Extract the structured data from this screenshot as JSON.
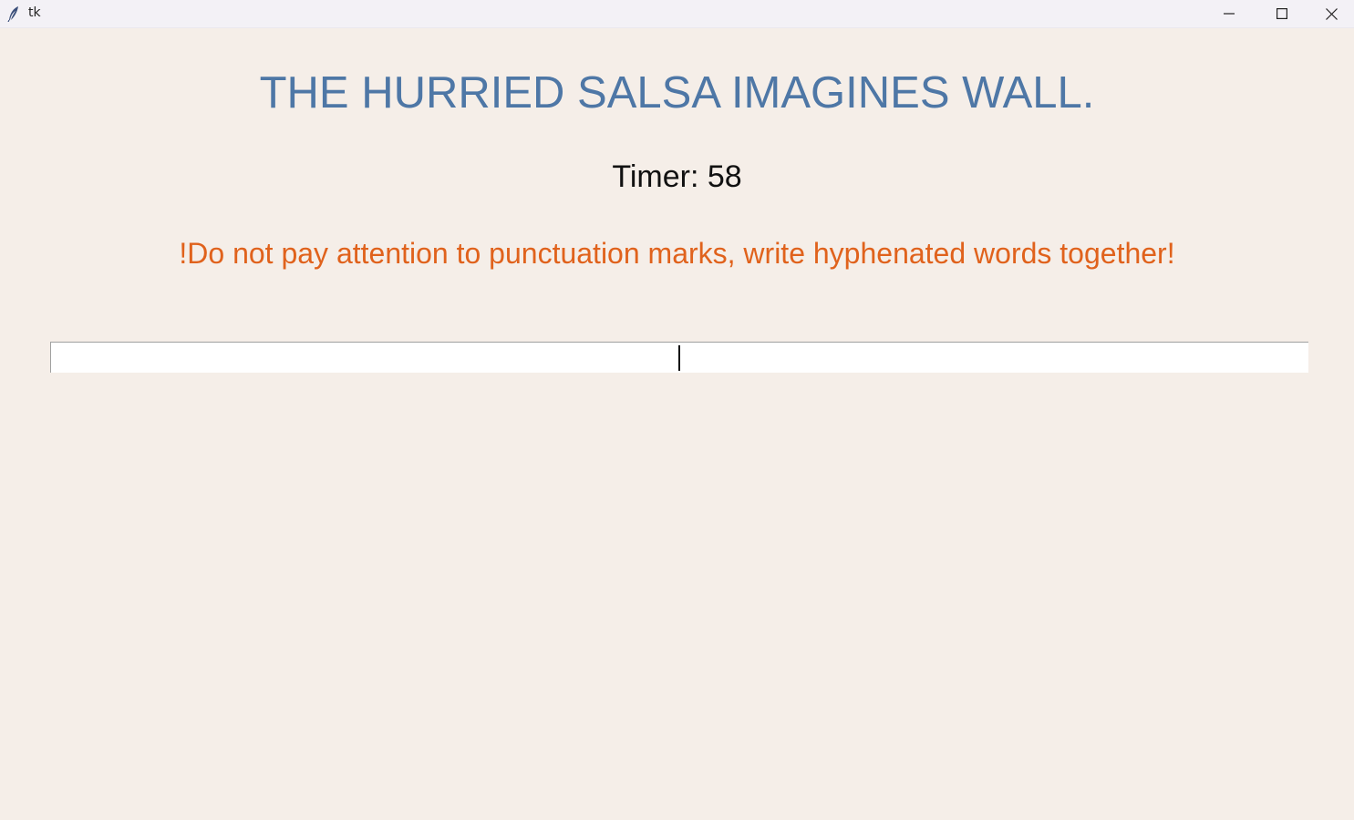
{
  "window": {
    "title": "tk",
    "controls": {
      "minimize_icon": "minimize-icon",
      "maximize_icon": "maximize-icon",
      "close_icon": "close-icon"
    }
  },
  "game": {
    "sentence": "THE HURRIED SALSA IMAGINES WALL.",
    "timer_text": "Timer: 58",
    "instructions": "!Do not pay attention to punctuation marks, write hyphenated words together!",
    "input_value": ""
  },
  "colors": {
    "background": "#f5eee8",
    "sentence": "#4e77a6",
    "timer": "#111111",
    "instructions": "#e0621c"
  }
}
